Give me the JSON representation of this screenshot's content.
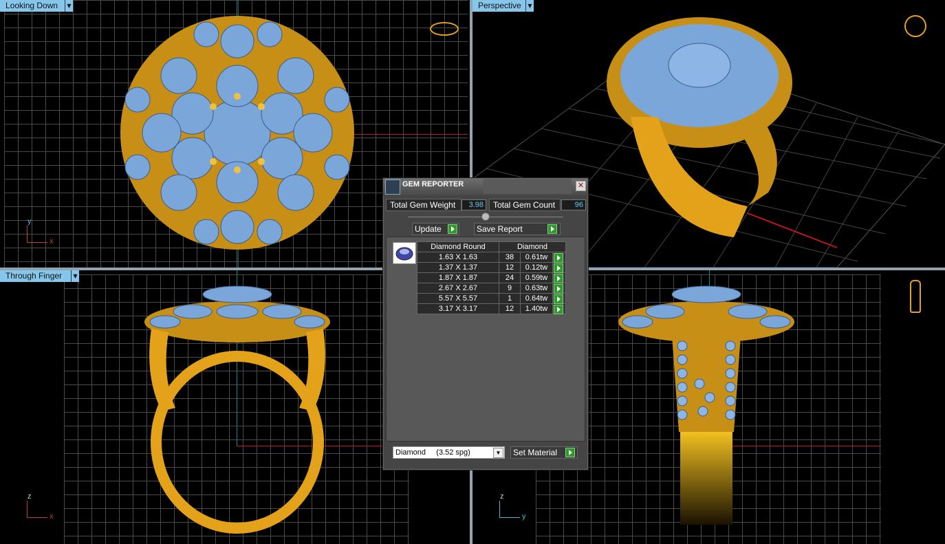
{
  "viewports": {
    "top_left": {
      "label": "Looking Down"
    },
    "top_right": {
      "label": "Perspective"
    },
    "bottom_left": {
      "label": "Through Finger"
    },
    "bottom_right": {
      "label": ""
    }
  },
  "axes": {
    "top_left": {
      "x": "x",
      "y": "y"
    },
    "bottom_left": {
      "x": "x",
      "y": "z"
    },
    "bottom_right": {
      "x": "y",
      "y": "z"
    }
  },
  "colors": {
    "gold": "#e3a21a",
    "gem": "#7aa6d9",
    "accent": "#86c6ea"
  },
  "gem_reporter": {
    "title": "GEM REPORTER",
    "total_weight_label": "Total Gem Weight",
    "total_weight_value": "3.98",
    "total_count_label": "Total Gem Count",
    "total_count_value": "96",
    "update_label": "Update",
    "save_label": "Save Report",
    "columns": [
      "Diamond Round",
      "Diamond"
    ],
    "rows": [
      {
        "size": "1.63 X 1.63",
        "count": "38",
        "weight": "0.61tw"
      },
      {
        "size": "1.37 X 1.37",
        "count": "12",
        "weight": "0.12tw"
      },
      {
        "size": "1.87 X 1.87",
        "count": "24",
        "weight": "0.59tw"
      },
      {
        "size": "2.67 X 2.67",
        "count": "9",
        "weight": "0.63tw"
      },
      {
        "size": "5.57 X 5.57",
        "count": "1",
        "weight": "0.64tw"
      },
      {
        "size": "3.17 X 3.17",
        "count": "12",
        "weight": "1.40tw"
      }
    ],
    "material_select": "Diamond     (3.52 spg)",
    "set_material_label": "Set Material"
  }
}
